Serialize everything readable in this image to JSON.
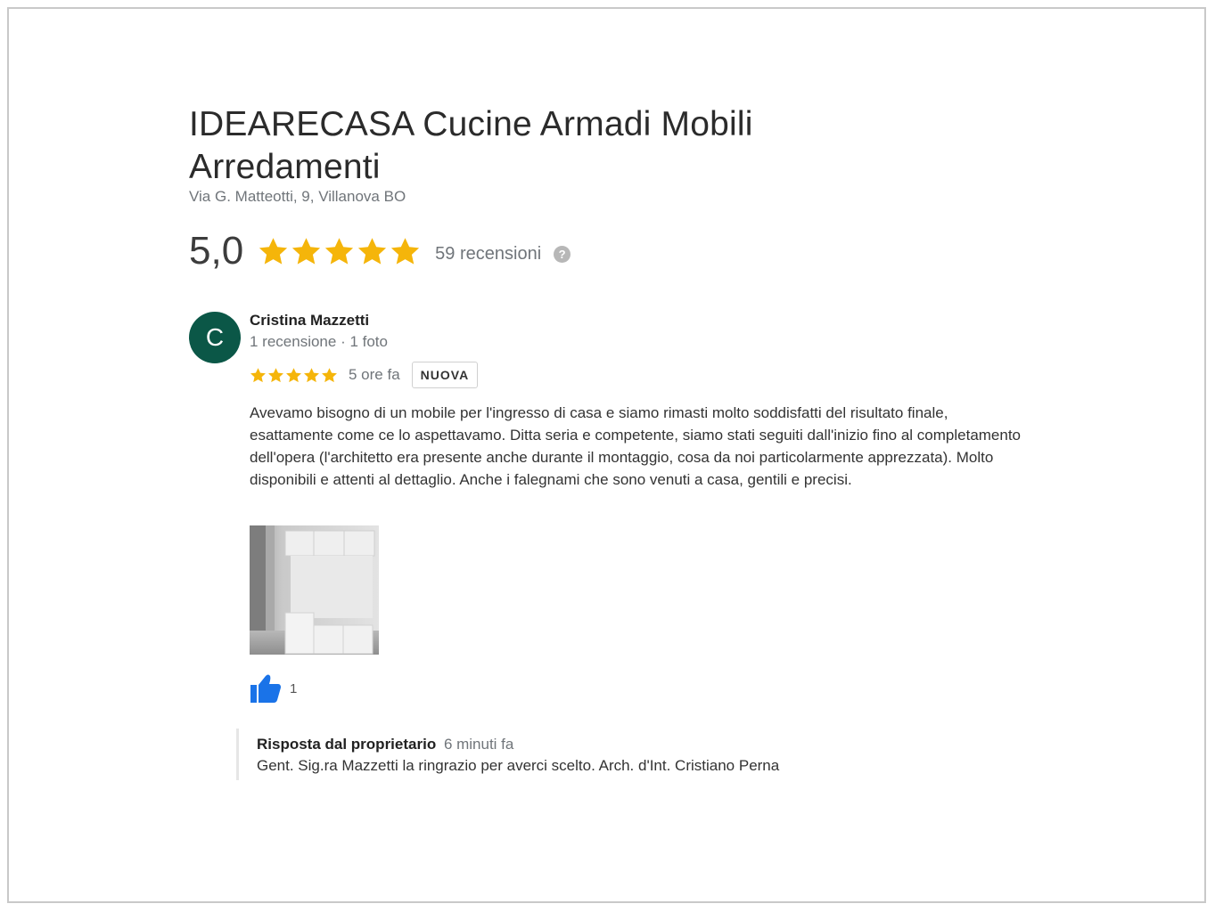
{
  "business": {
    "name": "IDEARECASA Cucine Armadi Mobili Arredamenti",
    "address": "Via G. Matteotti, 9, Villanova BO"
  },
  "summary": {
    "rating": "5,0",
    "stars": 5,
    "review_count_label": "59 recensioni",
    "help_icon": "?"
  },
  "review": {
    "avatar_initial": "C",
    "avatar_color": "#0b5747",
    "author": "Cristina Mazzetti",
    "author_meta": "1 recensione · 1 foto",
    "stars": 5,
    "time": "5 ore fa",
    "badge": "NUOVA",
    "text": "Avevamo bisogno di un mobile per l'ingresso di casa e siamo rimasti molto soddisfatti del risultato finale, esattamente come ce lo aspettavamo. Ditta seria e competente, siamo stati seguiti dall'inizio fino al completamento dell'opera (l'architetto era presente anche durante il montaggio, cosa da noi particolarmente apprezzata). Molto disponibili e attenti al dettaglio. Anche i falegnami che sono venuti a casa, gentili e precisi.",
    "likes": "1",
    "like_color": "#1a73e8"
  },
  "owner_reply": {
    "label": "Risposta dal proprietario",
    "time": "6 minuti fa",
    "text": "Gent. Sig.ra Mazzetti la ringrazio per averci scelto. Arch. d'Int. Cristiano Perna"
  },
  "colors": {
    "star": "#f5b50a",
    "secondary_text": "#70757a"
  }
}
